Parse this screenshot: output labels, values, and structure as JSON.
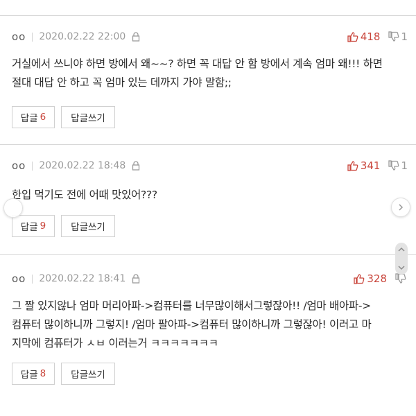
{
  "colors": {
    "accent": "#c9453b",
    "muted": "#9a9a9a",
    "border": "#d7d7d7",
    "text": "#2b2b2b"
  },
  "icons": {
    "upvote": "thumbs-up-icon",
    "downvote": "thumbs-down-icon",
    "lock": "lock-icon"
  },
  "comments": [
    {
      "user": "oo",
      "date": "2020.02.22 22:00",
      "upvotes": "418",
      "downvotes": "1",
      "lines": [
        "거실에서 쓰니야 하면 방에서 왜~~? 하면 꼭 대답 안 함 방에서 계속 엄마 왜!!! 하면",
        "절대 대답 안 하고 꼭 엄마 있는 데까지 가야 말함;;"
      ],
      "reply_label": "답글",
      "reply_count": "6",
      "write_label": "답글쓰기"
    },
    {
      "user": "oo",
      "date": "2020.02.22 18:48",
      "upvotes": "341",
      "downvotes": "1",
      "lines": [
        "한입 먹기도 전에 어때 맛있어???"
      ],
      "reply_label": "답글",
      "reply_count": "9",
      "write_label": "답글쓰기"
    },
    {
      "user": "oo",
      "date": "2020.02.22 18:41",
      "upvotes": "328",
      "downvotes": "",
      "lines": [
        "그 짤 있지않나 엄마 머리아파->컴퓨터를 너무많이해서그렇잖아!! /엄마 배아파->",
        "컴퓨터 많이하니까 그렇지! /엄마 팔아파->컴퓨터 많이하니까 그렇잖아! 이러고 마",
        "지막에 컴퓨터가 ㅅㅂ 이러는거 ㅋㅋㅋㅋㅋㅋㅋ"
      ],
      "reply_label": "답글",
      "reply_count": "8",
      "write_label": "답글쓰기"
    }
  ]
}
